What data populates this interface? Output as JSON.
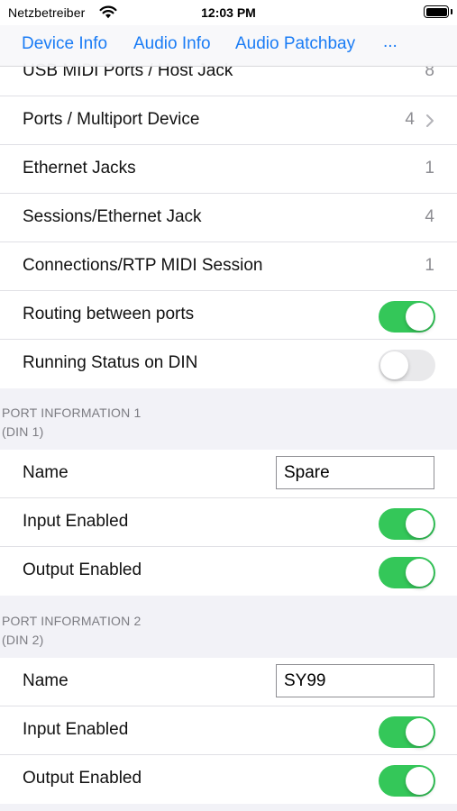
{
  "status_bar": {
    "carrier": "Netzbetreiber",
    "time": "12:03 PM"
  },
  "nav": {
    "tabs": [
      "Device Info",
      "Audio Info",
      "Audio Patchbay",
      "..."
    ]
  },
  "device_rows": [
    {
      "label": "USB MIDI Ports / Host Jack",
      "value": "8"
    },
    {
      "label": "Ports / Multiport Device",
      "value": "4"
    },
    {
      "label": "Ethernet Jacks",
      "value": "1"
    },
    {
      "label": "Sessions/Ethernet Jack",
      "value": "4"
    },
    {
      "label": "Connections/RTP MIDI Session",
      "value": "1"
    },
    {
      "label": "Routing between ports",
      "toggle": true
    },
    {
      "label": "Running Status on DIN",
      "toggle": false
    }
  ],
  "ports": [
    {
      "header": "PORT INFORMATION 1",
      "subheader": "(DIN 1)",
      "name_label": "Name",
      "name_value": "Spare",
      "input_label": "Input Enabled",
      "input_enabled": true,
      "output_label": "Output Enabled",
      "output_enabled": true
    },
    {
      "header": "PORT INFORMATION 2",
      "subheader": "(DIN 2)",
      "name_label": "Name",
      "name_value": "SY99",
      "input_label": "Input Enabled",
      "input_enabled": true,
      "output_label": "Output Enabled",
      "output_enabled": true
    }
  ],
  "colors": {
    "accent": "#1a7cf5",
    "toggle_on": "#34c759",
    "toggle_off": "#e9e9eb",
    "group_background": "#f2f2f7"
  }
}
